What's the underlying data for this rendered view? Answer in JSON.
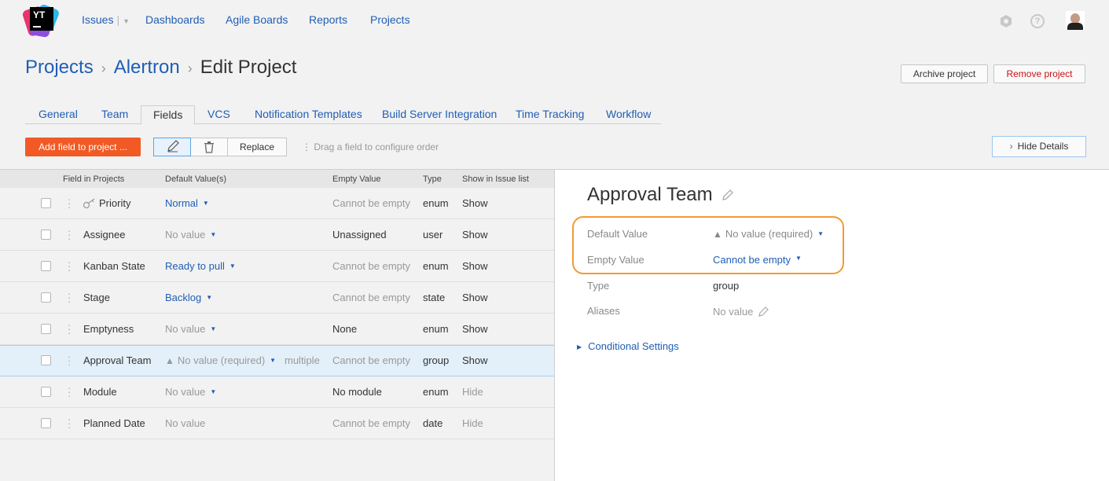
{
  "topnav": {
    "logo_text": "YT",
    "items": [
      "Issues",
      "Dashboards",
      "Agile Boards",
      "Reports",
      "Projects"
    ]
  },
  "breadcrumb": {
    "root": "Projects",
    "project": "Alertron",
    "current": "Edit Project"
  },
  "header_buttons": {
    "archive": "Archive project",
    "remove": "Remove project"
  },
  "tabs": [
    "General",
    "Team",
    "Fields",
    "VCS",
    "Notification Templates",
    "Build Server Integration",
    "Time Tracking",
    "Workflow"
  ],
  "active_tab": "Fields",
  "toolbar": {
    "add_field": "Add field to project ...",
    "replace": "Replace",
    "drag_hint": "Drag a field to configure order",
    "hide_details": "Hide Details"
  },
  "table": {
    "headers": [
      "Field in Projects",
      "Default Value(s)",
      "Empty Value",
      "Type",
      "Show in Issue list"
    ],
    "rows": [
      {
        "name": "Priority",
        "default": "Normal",
        "empty": "Cannot be empty",
        "type": "enum",
        "show": "Show"
      },
      {
        "name": "Assignee",
        "default": "No value",
        "empty": "Unassigned",
        "type": "user",
        "show": "Show"
      },
      {
        "name": "Kanban State",
        "default": "Ready to pull",
        "empty": "Cannot be empty",
        "type": "enum",
        "show": "Show"
      },
      {
        "name": "Stage",
        "default": "Backlog",
        "empty": "Cannot be empty",
        "type": "state",
        "show": "Show"
      },
      {
        "name": "Emptyness",
        "default": "No value",
        "empty": "None",
        "type": "enum",
        "show": "Show"
      },
      {
        "name": "Approval Team",
        "default": "No value (required)",
        "extra": "multiple",
        "empty": "Cannot be empty",
        "type": "group",
        "show": "Show"
      },
      {
        "name": "Module",
        "default": "No value",
        "empty": "No module",
        "type": "enum",
        "show": "Hide"
      },
      {
        "name": "Planned Date",
        "default": "No value",
        "empty": "Cannot be empty",
        "type": "date",
        "show": "Hide"
      }
    ]
  },
  "details": {
    "title": "Approval Team",
    "default_label": "Default Value",
    "default_value": "No value (required)",
    "empty_label": "Empty Value",
    "empty_value": "Cannot be empty",
    "type_label": "Type",
    "type_value": "group",
    "aliases_label": "Aliases",
    "aliases_value": "No value",
    "conditional": "Conditional Settings"
  },
  "colors": {
    "link": "#1f5eb5",
    "primary_button": "#f15a24",
    "highlight": "#f39a34",
    "selected_row": "#e3f0fa"
  }
}
